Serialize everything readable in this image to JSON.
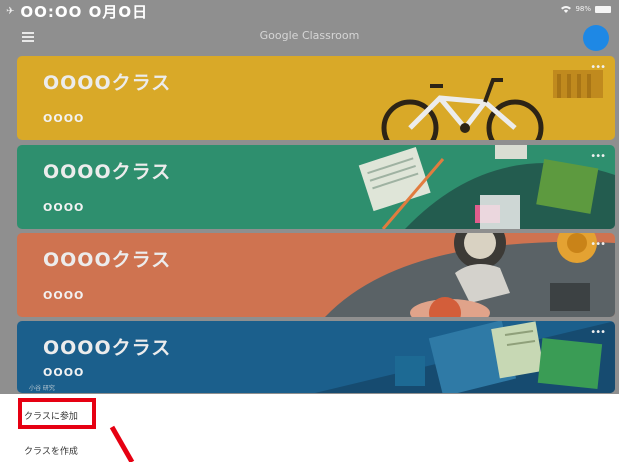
{
  "status": {
    "time": "OO:OO O月O日",
    "battery": "98%",
    "airplane_icon": "airplane-icon",
    "wifi_icon": "wifi-icon"
  },
  "app": {
    "title": "Google Classroom",
    "menu_icon": "hamburger-menu-icon",
    "avatar_color": "#1e88e5"
  },
  "classes": [
    {
      "name": "OOOOクラス",
      "section": "OOOO",
      "color": "#d9a928"
    },
    {
      "name": "OOOOクラス",
      "section": "OOOO",
      "color": "#2e8f6e"
    },
    {
      "name": "OOOOクラス",
      "section": "OOOO",
      "color": "#cf7350"
    },
    {
      "name": "OOOOクラス",
      "section": "OOOO",
      "color": "#1b5f8c",
      "extra": "小谷 研究"
    }
  ],
  "menu": {
    "join_label": "クラスに参加",
    "create_label": "クラスを作成"
  },
  "annotation": {
    "color": "#e60012"
  }
}
